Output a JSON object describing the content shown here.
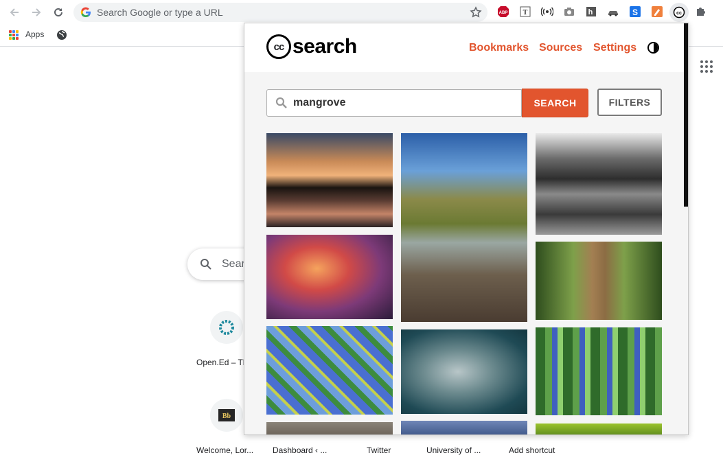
{
  "browser": {
    "omnibox_placeholder": "Search Google or type a URL",
    "bookmarks": {
      "apps_label": "Apps"
    },
    "extensions": [
      "adblock-plus-icon",
      "text-icon",
      "broadcast-icon",
      "camera-icon",
      "hypothesis-icon",
      "car-icon",
      "s-icon",
      "pen-icon",
      "creative-commons-icon",
      "puzzle-icon"
    ]
  },
  "ntp": {
    "search_placeholder": "Sear",
    "shortcuts_row1": [
      {
        "label": "Open.Ed – Tl"
      }
    ],
    "shortcuts_row2": [
      {
        "label": "Welcome, Lor..."
      },
      {
        "label": "Dashboard ‹ ..."
      },
      {
        "label": "Twitter"
      },
      {
        "label": "University of ..."
      },
      {
        "label": "Add shortcut"
      }
    ]
  },
  "popup": {
    "logo_mark": "cc",
    "logo_word": "search",
    "nav": {
      "bookmarks": "Bookmarks",
      "sources": "Sources",
      "settings": "Settings"
    },
    "search": {
      "value": "mangrove",
      "button": "SEARCH",
      "filters": "FILTERS"
    },
    "accent_color": "#e2552e",
    "images": [
      {
        "alt": "sunset over mangrove water"
      },
      {
        "alt": "mangrove tree on tidal flat"
      },
      {
        "alt": "black and white mangrove roots"
      },
      {
        "alt": "sunset through mangrove branches"
      },
      {
        "alt": "crab on mangrove trunk"
      },
      {
        "alt": "collage of mangrove leaves"
      },
      {
        "alt": "fish underwater"
      },
      {
        "alt": "grid of mangrove plant photos"
      }
    ]
  }
}
